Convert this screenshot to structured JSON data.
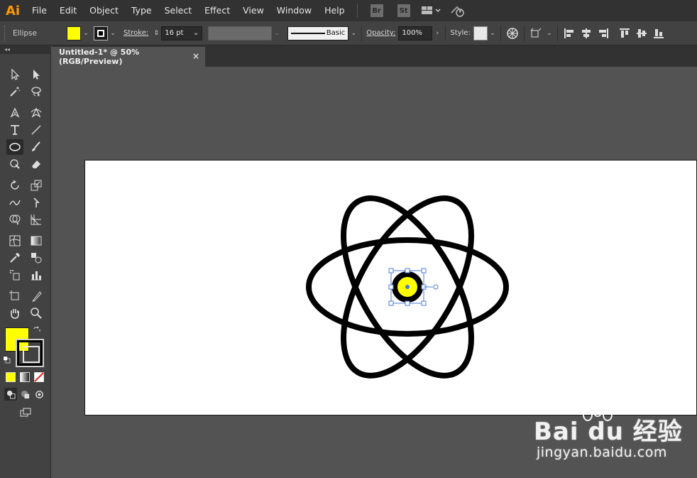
{
  "app": {
    "logo": "Ai"
  },
  "menu": [
    "File",
    "Edit",
    "Object",
    "Type",
    "Select",
    "Effect",
    "View",
    "Window",
    "Help"
  ],
  "menubar_badges": [
    "Br",
    "St"
  ],
  "control": {
    "object_type": "Ellipse",
    "fill_color": "#ffff00",
    "stroke_color": "#000000",
    "stroke_label": "Stroke:",
    "stroke_weight": "16 pt",
    "brush_label": "Basic",
    "opacity_label": "Opacity:",
    "opacity_value": "100%",
    "style_label": "Style:"
  },
  "document": {
    "tab_title": "Untitled-1* @ 50% (RGB/Preview)",
    "close_glyph": "×"
  },
  "toolbar": {
    "collapse_glyph": "◂◂",
    "fill_color": "#ffff00",
    "stroke_color": "#000000",
    "active_tool": "ellipse-tool"
  },
  "artwork": {
    "orbit_color": "#000000",
    "nucleus_fill": "#ffff00",
    "selection_color": "#4a7bd4"
  },
  "watermark": {
    "brand": "Bai du 经验",
    "url": "jingyan.baidu.com"
  }
}
